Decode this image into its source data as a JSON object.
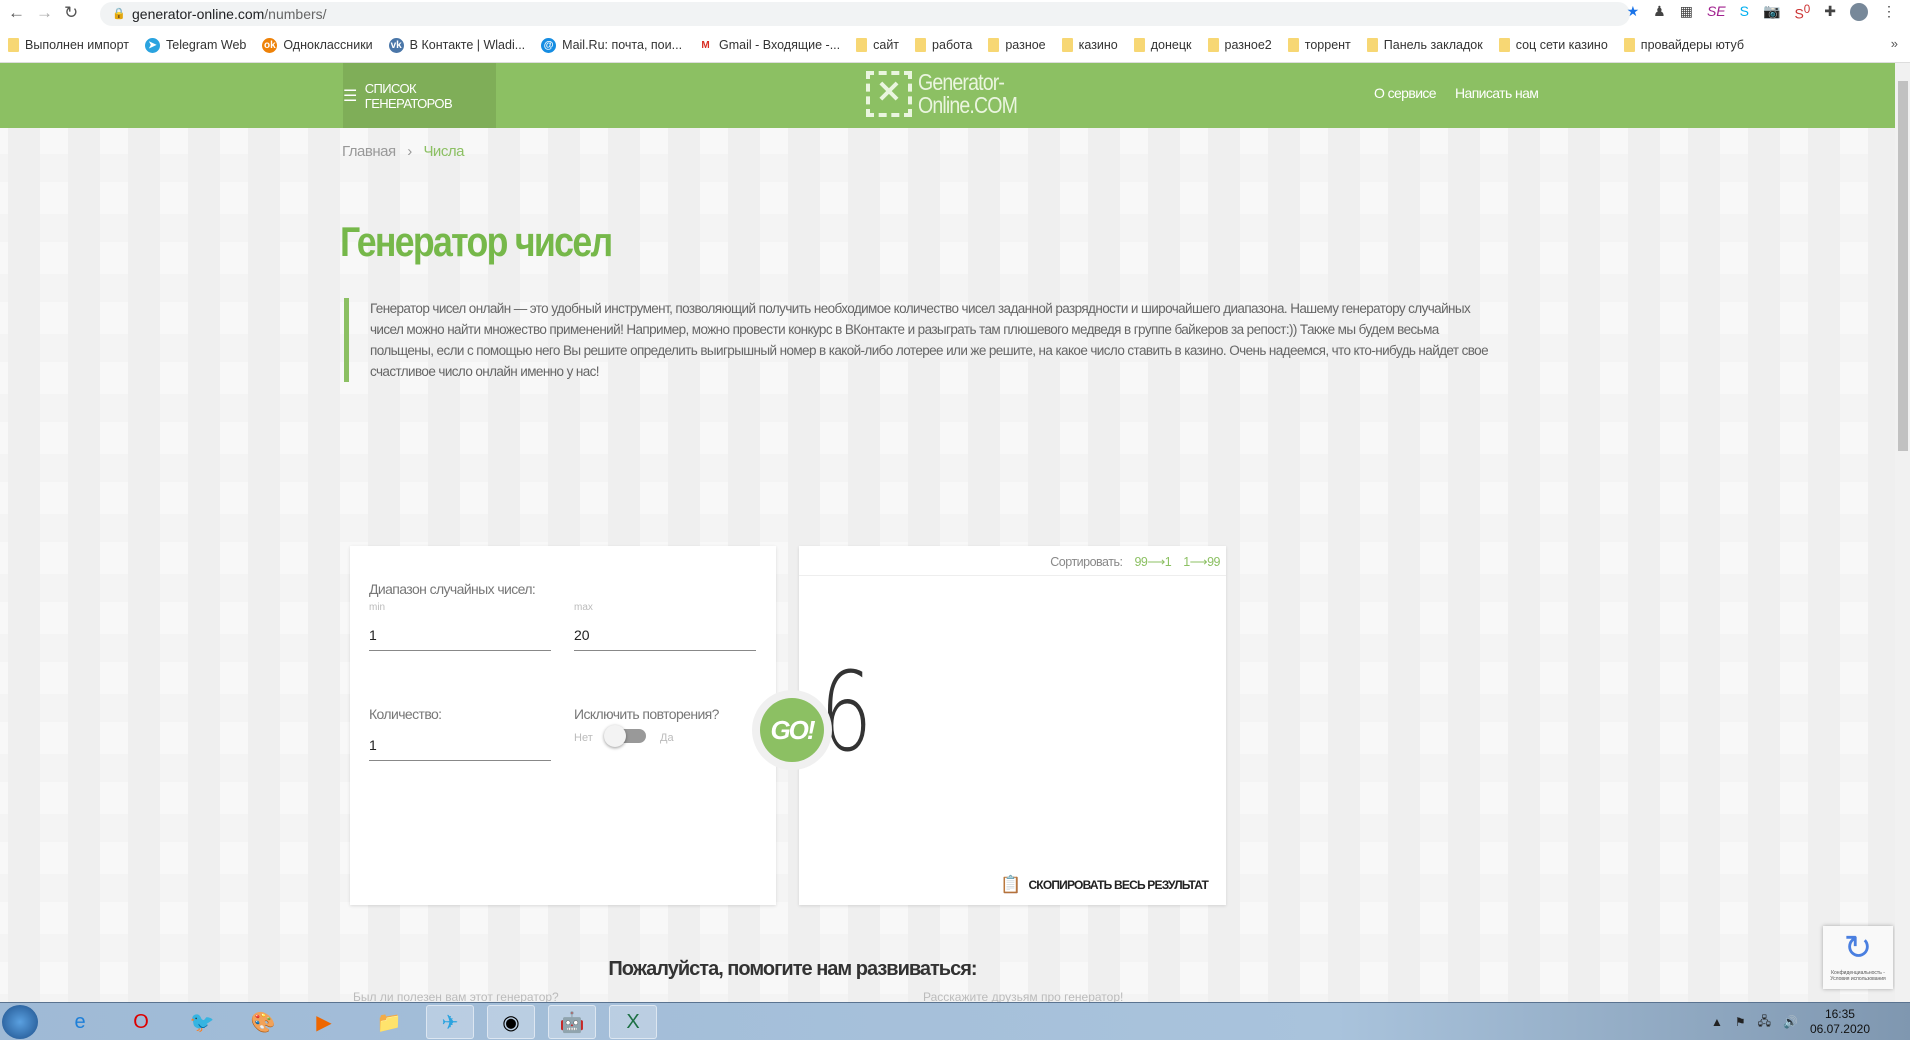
{
  "browser": {
    "url_host": "generator-online.com",
    "url_path": "/numbers/",
    "bookmarks": [
      {
        "label": "Выполнен импорт",
        "icon": "folder-icon"
      },
      {
        "label": "Telegram Web",
        "icon": "telegram-icon"
      },
      {
        "label": "Одноклассники",
        "icon": "odnoklassniki-icon"
      },
      {
        "label": "В Контакте | Wladi...",
        "icon": "vk-icon"
      },
      {
        "label": "Mail.Ru: почта, пои...",
        "icon": "mailru-icon"
      },
      {
        "label": "Gmail - Входящие -...",
        "icon": "gmail-icon"
      },
      {
        "label": "сайт",
        "icon": "folder-icon"
      },
      {
        "label": "работа",
        "icon": "folder-icon"
      },
      {
        "label": "разное",
        "icon": "folder-icon"
      },
      {
        "label": "казино",
        "icon": "folder-icon"
      },
      {
        "label": "донецк",
        "icon": "folder-icon"
      },
      {
        "label": "разное2",
        "icon": "folder-icon"
      },
      {
        "label": "торрент",
        "icon": "folder-icon"
      },
      {
        "label": "Панель закладок",
        "icon": "folder-icon"
      },
      {
        "label": "соц сети казино",
        "icon": "folder-icon"
      },
      {
        "label": "провайдеры ютуб",
        "icon": "folder-icon"
      }
    ],
    "more": "»",
    "ext_badge": "0"
  },
  "header": {
    "menu_label": "СПИСОК ГЕНЕРАТОРОВ",
    "logo_line1": "Generator-",
    "logo_line2": "Online.COM",
    "nav": [
      "О сервисе",
      "Написать нам"
    ]
  },
  "breadcrumb": {
    "home": "Главная",
    "sep": "›",
    "current": "Числа"
  },
  "page": {
    "title": "Генератор чисел",
    "intro": "Генератор чисел онлайн — это удобный инструмент, позволяющий получить необходимое количество чисел заданной разрядности и широчайшего диапазона. Нашему генератору случайных чисел можно найти множество применений! Например, можно провести конкурс в ВКонтакте и разыграть там плюшевого медведя в группе байкеров за репост:)) Также мы будем весьма польщены, если с помощью него Вы решите определить выигрышный номер в какой-либо лотерее или же решите, на какое число ставить в казино. Очень надеемся, что кто-нибудь найдет свое счастливое число онлайн именно у нас!"
  },
  "form": {
    "range_label": "Диапазон случайных чисел:",
    "min_label": "min",
    "max_label": "max",
    "min_value": "1",
    "max_value": "20",
    "count_label": "Количество:",
    "count_value": "1",
    "exclude_label": "Исключить повторения?",
    "no": "Нет",
    "yes": "Да",
    "exclude_on": false,
    "go": "GO!"
  },
  "result": {
    "sort_label": "Сортировать:",
    "sort_desc": "99⟶1",
    "sort_asc": "1⟶99",
    "value": "6",
    "copy": "СКОПИРОВАТЬ ВЕСЬ РЕЗУЛЬТАТ"
  },
  "footer": {
    "help": "Пожалуйста, помогите нам развиваться:",
    "q1": "Был ли полезен вам этот генератор?",
    "q2": "Расскажите друзьям про генератор!"
  },
  "recaptcha": {
    "text": "Конфиденциальность - Условия использования"
  },
  "taskbar": {
    "time": "16:35",
    "date": "06.07.2020"
  }
}
